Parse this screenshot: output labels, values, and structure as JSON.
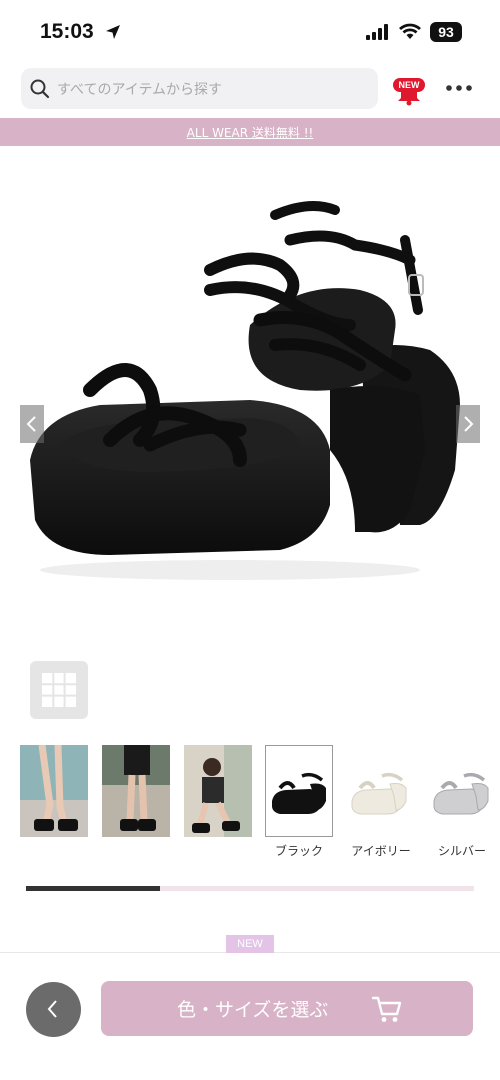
{
  "status": {
    "time": "15:03",
    "battery": "93"
  },
  "header": {
    "search_placeholder": "すべてのアイテムから探す",
    "new_badge": "NEW"
  },
  "promo": {
    "text": "ALL WEAR 送料無料 !!"
  },
  "thumbnails": [
    {
      "kind": "model-photo-1",
      "label": ""
    },
    {
      "kind": "model-photo-2",
      "label": ""
    },
    {
      "kind": "model-photo-3",
      "label": ""
    },
    {
      "kind": "color-black",
      "label": "ブラック",
      "selected": true
    },
    {
      "kind": "color-ivory",
      "label": "アイボリー"
    },
    {
      "kind": "color-silver",
      "label": "シルバー"
    }
  ],
  "gallery_progress": 0.3,
  "new_tag": "NEW",
  "bottom_bar": {
    "cta_label": "色・サイズを選ぶ"
  },
  "colors": {
    "accent_pink": "#d8b2c6",
    "badge_red": "#e0182d"
  }
}
